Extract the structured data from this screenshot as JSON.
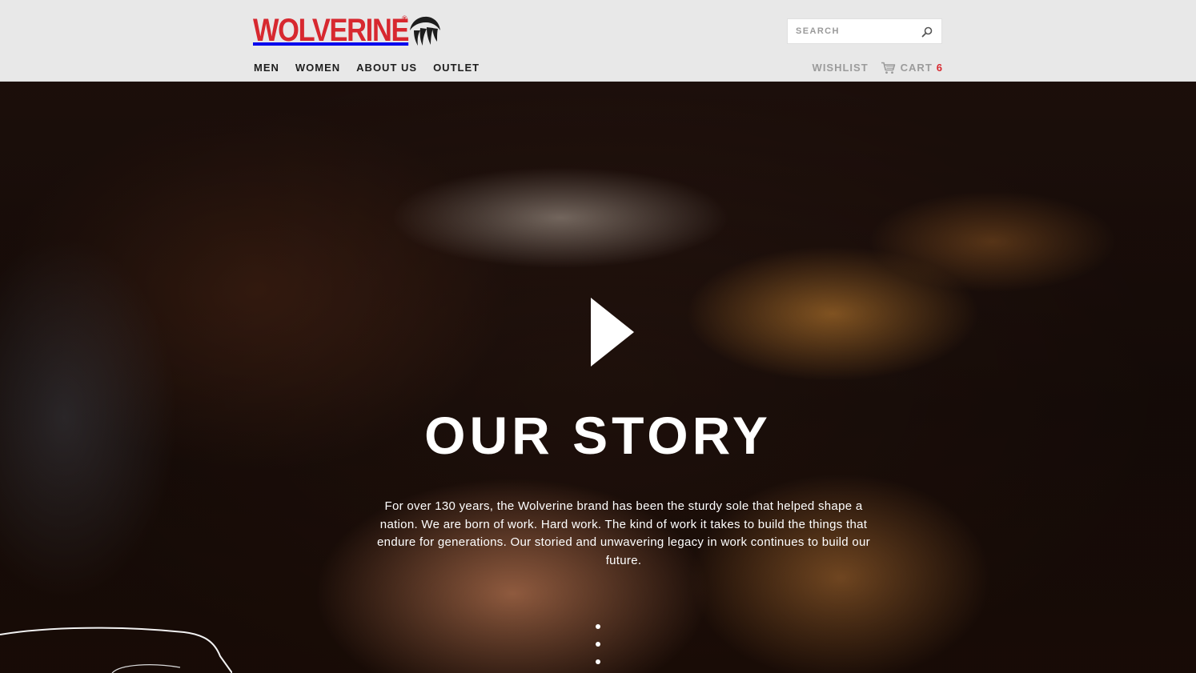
{
  "brand": {
    "name": "WOLVERINE",
    "registered_mark": "®",
    "accent_color": "#d7282f",
    "logo_icon": "claw-mark-icon"
  },
  "header": {
    "search": {
      "placeholder": "SEARCH",
      "value": "",
      "icon": "search-icon"
    },
    "nav": [
      {
        "label": "MEN"
      },
      {
        "label": "WOMEN"
      },
      {
        "label": "ABOUT US"
      },
      {
        "label": "OUTLET"
      }
    ],
    "utility": {
      "wishlist_label": "WISHLIST",
      "cart_label": "CART",
      "cart_count": "6",
      "cart_icon": "shopping-cart-icon"
    }
  },
  "hero": {
    "play_icon": "play-icon",
    "title": "OUR STORY",
    "body": "For over 130 years, the Wolverine brand has been the sturdy sole that helped shape a nation. We are born of work. Hard work. The kind of work it takes to build the things that endure for generations. Our storied and unwavering legacy in work continues to build our future.",
    "slide_indicators": 3
  }
}
